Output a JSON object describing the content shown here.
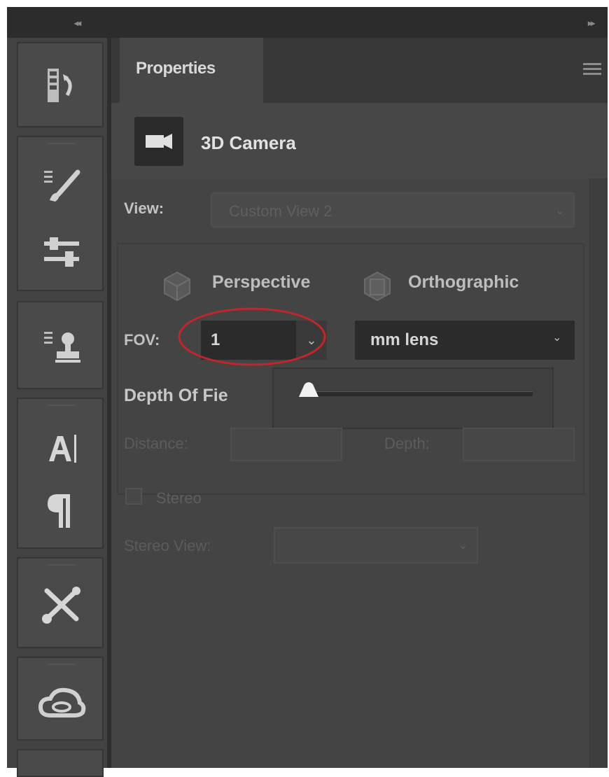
{
  "panel": {
    "tab_label": "Properties",
    "menu_icon": "hamburger-menu-icon"
  },
  "camera": {
    "icon": "video-camera-icon",
    "title": "3D Camera"
  },
  "view": {
    "label": "View:",
    "value": "Custom View 2"
  },
  "projection": {
    "perspective_label": "Perspective",
    "orthographic_label": "Orthographic",
    "perspective_icon": "perspective-cube-icon",
    "orthographic_icon": "orthographic-cube-icon"
  },
  "fov": {
    "label": "FOV:",
    "value": "1",
    "unit_value": "mm lens",
    "highlight_color": "#c0262b"
  },
  "depth_of_field": {
    "label": "Depth Of Fie",
    "slider_value": 0,
    "distance_label": "Distance:",
    "depth_label": "Depth:"
  },
  "stereo": {
    "label": "Stereo",
    "checked": false,
    "view_label": "Stereo View:"
  },
  "toolstrip": {
    "tools": [
      "history-icon",
      "brush-presets-icon",
      "adjustments-icon",
      "clone-source-icon",
      "character-icon",
      "paragraph-icon",
      "tools-icon",
      "creative-cloud-icon"
    ]
  }
}
